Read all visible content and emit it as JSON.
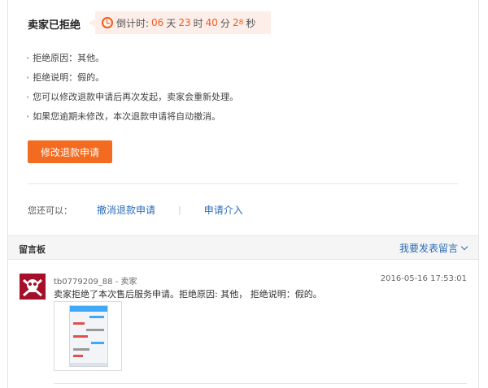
{
  "status": {
    "title": "卖家已拒绝",
    "countdown_label": "倒计时:",
    "days": "06",
    "day_unit": "天",
    "hours": "23",
    "hour_unit": "时",
    "minutes": "40",
    "minute_unit": "分",
    "seconds": "2",
    "seconds_sup": "8",
    "second_unit": "秒"
  },
  "bullets": [
    "拒绝原因：其他。",
    "拒绝说明：假的。",
    "您可以修改退款申请后再次发起，卖家会重新处理。",
    "如果您逾期未修改，本次退款申请将自动撤消。"
  ],
  "modify_button": "修改退款申请",
  "options": {
    "label": "您还可以：",
    "cancel": "撤消退款申请",
    "separator": "|",
    "intervene": "申请介入"
  },
  "messages": {
    "title": "留言板",
    "post_link": "我要发表留言",
    "items": [
      {
        "user": "tb0779209_88 - 卖家",
        "time": "2016-05-16 17:53:01",
        "text": "卖家拒绝了本次售后服务申请。拒绝原因: 其他， 拒绝说明：假的。"
      }
    ]
  },
  "colors": {
    "accent": "#f36b20",
    "link": "#2b6cb7",
    "countdown_bg": "#fdeee9"
  }
}
